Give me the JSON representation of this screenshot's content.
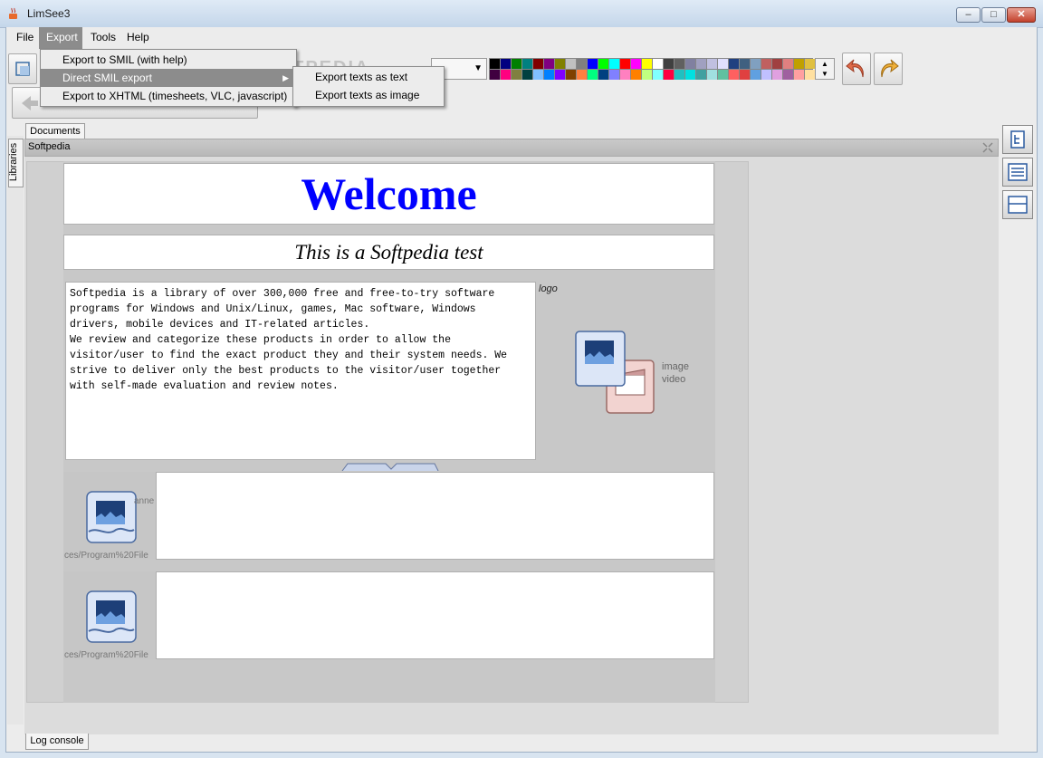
{
  "window": {
    "title": "LimSee3"
  },
  "menubar": {
    "items": [
      "File",
      "Export",
      "Tools",
      "Help"
    ],
    "active": "Export"
  },
  "export_menu": {
    "items": [
      "Export to SMIL (with help)",
      "Direct SMIL export",
      "Export to XHTML (timesheets, VLC, javascript)"
    ],
    "selected": "Direct SMIL export",
    "submenu": [
      "Export texts as text",
      "Export texts as image"
    ]
  },
  "watermark": "SOFTPEDIA",
  "palette": {
    "row1": [
      "#000000",
      "#000080",
      "#008000",
      "#008080",
      "#800000",
      "#800080",
      "#808000",
      "#c0c0c0",
      "#808080",
      "#0000ff",
      "#00ff00",
      "#00ffff",
      "#ff0000",
      "#ff00ff",
      "#ffff00",
      "#ffffff",
      "#404040",
      "#606060",
      "#8080a0",
      "#a0a0c0",
      "#c0c0e0",
      "#e0e0ff",
      "#204080",
      "#406080",
      "#80a0c0",
      "#c06060",
      "#a04040",
      "#e08080",
      "#c0a000",
      "#e0c040"
    ],
    "row2": [
      "#400040",
      "#ff0080",
      "#808040",
      "#004040",
      "#80c0ff",
      "#0080ff",
      "#8000ff",
      "#804000",
      "#ff8040",
      "#00ff80",
      "#004080",
      "#8080ff",
      "#ff80c0",
      "#ff8000",
      "#c0ff80",
      "#80ffff",
      "#ff0040",
      "#20c0c0",
      "#00e0e0",
      "#40a0a0",
      "#a0e0e0",
      "#60c0a0",
      "#ff6060",
      "#e04040",
      "#60a0e0",
      "#c0c0ff",
      "#e0a0e0",
      "#a060a0",
      "#ffa0a0",
      "#ffe0a0"
    ]
  },
  "tabs": {
    "documents": "Documents",
    "libraries": "Libraries",
    "log_console": "Log console"
  },
  "panel": {
    "title": "Softpedia"
  },
  "document": {
    "welcome": "Welcome",
    "subtitle": "This is a Softpedia test",
    "body": "Softpedia is a library of over 300,000 free and free-to-try software\nprograms for Windows and Unix/Linux, games, Mac software, Windows\ndrivers, mobile devices and IT-related articles.\nWe review and categorize these products in order to allow the\nvisitor/user to find the exact product they and their system needs. We\nstrive to deliver only the best products to the visitor/user together\nwith self-made evaluation and review notes.",
    "logo_label": "logo",
    "media_labels": [
      "image",
      "video"
    ],
    "row_path": "ces/Program%20File",
    "row_cut_label": "anne"
  },
  "colors": {
    "welcome": "#0000ff",
    "menu_highlight": "#8c8c8c"
  }
}
